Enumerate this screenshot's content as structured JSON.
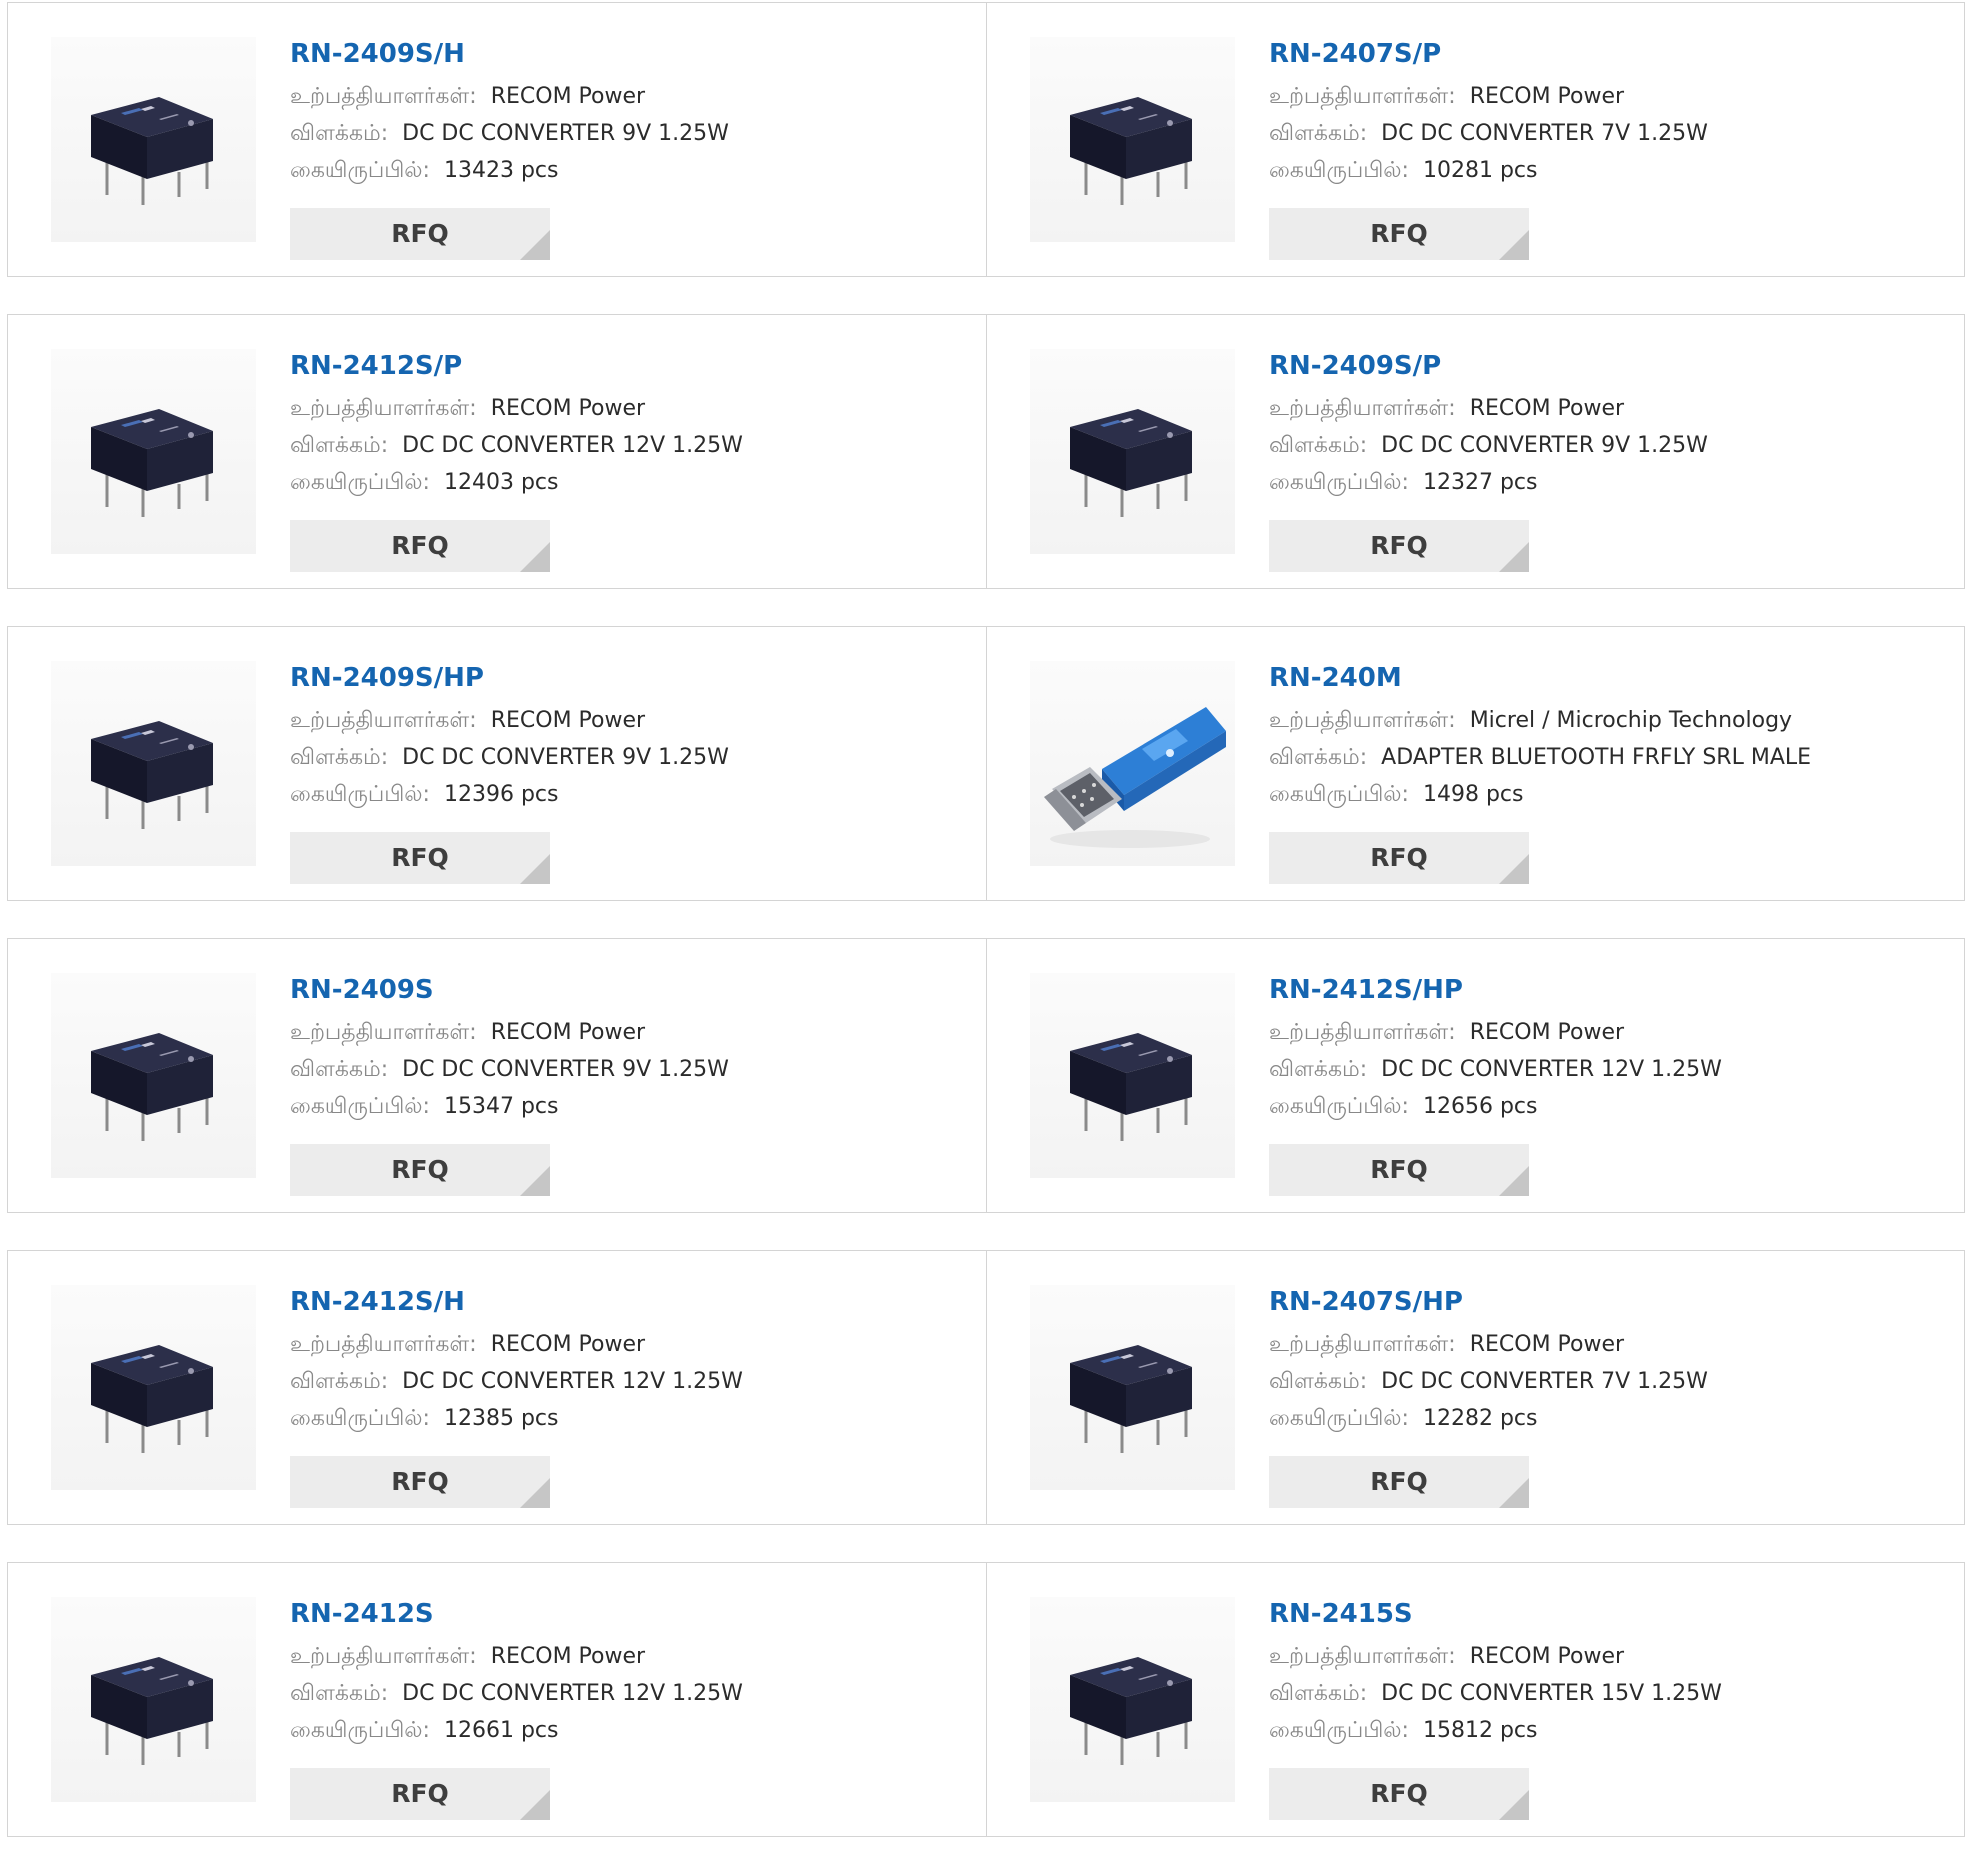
{
  "labels": {
    "manufacturer": "உற்பத்தியாளர்கள்:",
    "description": "விளக்கம்:",
    "stock": "கையிருப்பில்:",
    "rfq": "RFQ"
  },
  "products": [
    {
      "name": "RN-2409S/H",
      "manufacturer": "RECOM Power",
      "description": "DC DC CONVERTER 9V 1.25W",
      "stock": "13423 pcs",
      "image": "dc-converter-module"
    },
    {
      "name": "RN-2407S/P",
      "manufacturer": "RECOM Power",
      "description": "DC DC CONVERTER 7V 1.25W",
      "stock": "10281 pcs",
      "image": "dc-converter-module"
    },
    {
      "name": "RN-2412S/P",
      "manufacturer": "RECOM Power",
      "description": "DC DC CONVERTER 12V 1.25W",
      "stock": "12403 pcs",
      "image": "dc-converter-module"
    },
    {
      "name": "RN-2409S/P",
      "manufacturer": "RECOM Power",
      "description": "DC DC CONVERTER 9V 1.25W",
      "stock": "12327 pcs",
      "image": "dc-converter-module"
    },
    {
      "name": "RN-2409S/HP",
      "manufacturer": "RECOM Power",
      "description": "DC DC CONVERTER 9V 1.25W",
      "stock": "12396 pcs",
      "image": "dc-converter-module"
    },
    {
      "name": "RN-240M",
      "manufacturer": "Micrel / Microchip Technology",
      "description": "ADAPTER BLUETOOTH FRFLY SRL MALE",
      "stock": "1498 pcs",
      "image": "bluetooth-adapter"
    },
    {
      "name": "RN-2409S",
      "manufacturer": "RECOM Power",
      "description": "DC DC CONVERTER 9V 1.25W",
      "stock": "15347 pcs",
      "image": "dc-converter-module"
    },
    {
      "name": "RN-2412S/HP",
      "manufacturer": "RECOM Power",
      "description": "DC DC CONVERTER 12V 1.25W",
      "stock": "12656 pcs",
      "image": "dc-converter-module"
    },
    {
      "name": "RN-2412S/H",
      "manufacturer": "RECOM Power",
      "description": "DC DC CONVERTER 12V 1.25W",
      "stock": "12385 pcs",
      "image": "dc-converter-module"
    },
    {
      "name": "RN-2407S/HP",
      "manufacturer": "RECOM Power",
      "description": "DC DC CONVERTER 7V 1.25W",
      "stock": "12282 pcs",
      "image": "dc-converter-module"
    },
    {
      "name": "RN-2412S",
      "manufacturer": "RECOM Power",
      "description": "DC DC CONVERTER 12V 1.25W",
      "stock": "12661 pcs",
      "image": "dc-converter-module"
    },
    {
      "name": "RN-2415S",
      "manufacturer": "RECOM Power",
      "description": "DC DC CONVERTER 15V 1.25W",
      "stock": "15812 pcs",
      "image": "dc-converter-module"
    }
  ]
}
